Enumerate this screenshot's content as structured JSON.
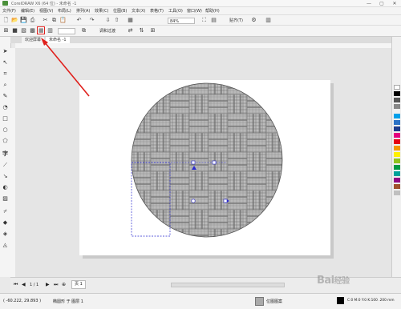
{
  "window": {
    "title": "CorelDRAW X6 (64 位) - 未命名 -1",
    "controls": {
      "minimize": "—",
      "maximize": "▢",
      "close": "✕"
    }
  },
  "menubar": {
    "items": [
      "文件(F)",
      "编辑(E)",
      "视图(V)",
      "布局(L)",
      "排列(A)",
      "效果(C)",
      "位图(B)",
      "文本(X)",
      "表格(T)",
      "工具(O)",
      "窗口(W)",
      "帮助(H)"
    ]
  },
  "toolbar1": {
    "zoom_value": "84%",
    "snap_label": "贴齐(T)"
  },
  "toolbar2": {
    "edit_fill_label": "调和过渡"
  },
  "tabs": {
    "welcome": "欢迎屏幕",
    "document": "未命名 -1"
  },
  "page_nav": {
    "page_label": "1 / 1",
    "page_tab": "页 1"
  },
  "status": {
    "coords": "( -60.222, 29.893 )",
    "object_info": "椭圆形 于 图层 1",
    "fill_name": "位图图案",
    "outline_info": "C:0 M:0 Y:0 K:100  .200 mm"
  },
  "watermark": {
    "brand": "Bai",
    "suffix": "经验"
  },
  "colors": {
    "accent_red": "#e0201c",
    "selection_blue": "#2a2ad0"
  },
  "palette": [
    "#ffffff",
    "#000000",
    "#555555",
    "#888888",
    "#00a0e9",
    "#2b72c6",
    "#1d3c8c",
    "#e4007f",
    "#e60012",
    "#f39800",
    "#fff100",
    "#8fc31f",
    "#009944",
    "#00a29a",
    "#920783",
    "#a0522d",
    "#c0c0c0"
  ]
}
